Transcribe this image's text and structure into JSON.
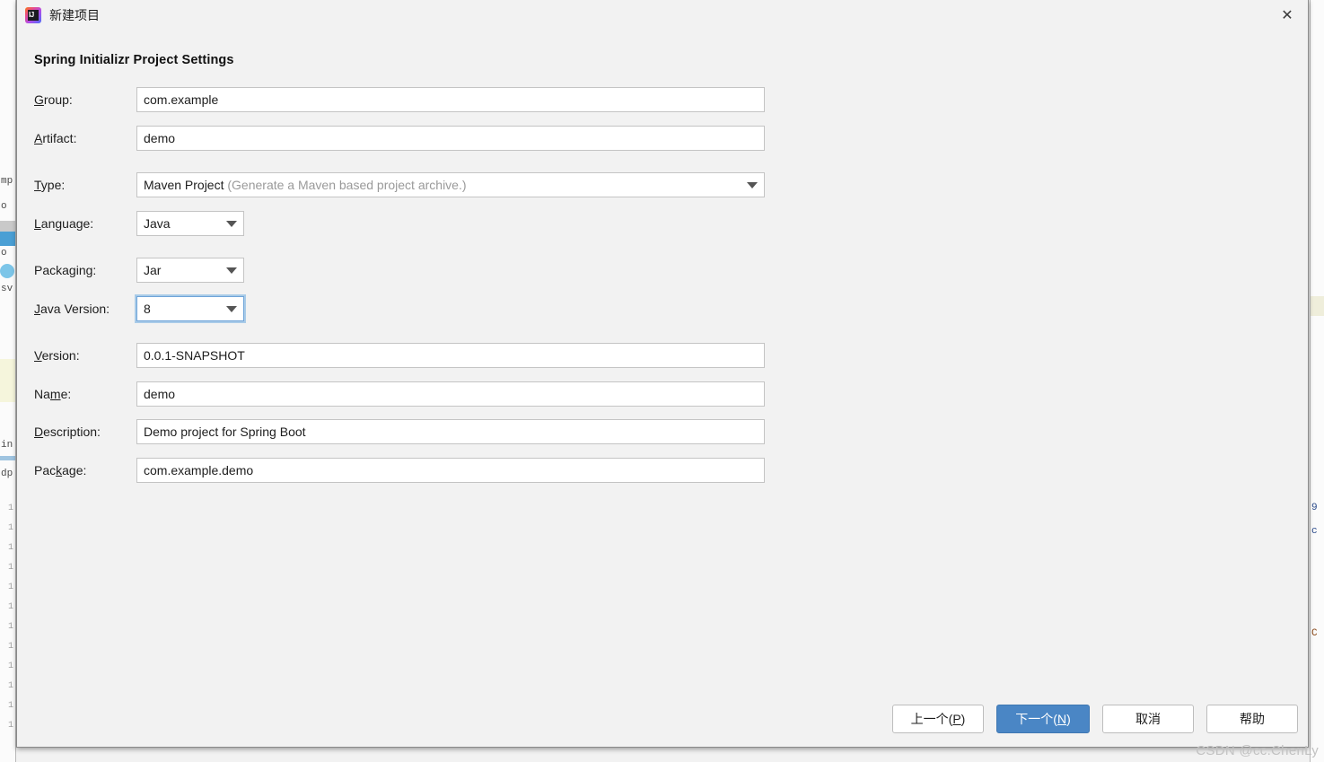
{
  "window": {
    "title": "新建项目",
    "icon": "intellij-idea-icon",
    "icon_mark": "IJ",
    "close_label": "✕"
  },
  "dialog": {
    "heading": "Spring Initializr Project Settings"
  },
  "fields": {
    "group": {
      "label_pre": "",
      "label_mnemonic": "G",
      "label_post": "roup:",
      "value": "com.example",
      "placeholder": ""
    },
    "artifact": {
      "label_pre": "",
      "label_mnemonic": "A",
      "label_post": "rtifact:",
      "value": "demo",
      "placeholder": ""
    },
    "type": {
      "label_pre": "",
      "label_mnemonic": "T",
      "label_post": "ype:",
      "value": "Maven Project",
      "hint": " (Generate a Maven based project archive.)"
    },
    "language": {
      "label_pre": "",
      "label_mnemonic": "L",
      "label_post": "anguage:",
      "value": "Java"
    },
    "packaging": {
      "label_pre": "Packa",
      "label_mnemonic": "g",
      "label_post": "ing:",
      "value": "Jar"
    },
    "java_version": {
      "label_pre": "",
      "label_mnemonic": "J",
      "label_post": "ava Version:",
      "value": "8",
      "focused": true
    },
    "version": {
      "label_pre": "",
      "label_mnemonic": "V",
      "label_post": "ersion:",
      "value": "0.0.1-SNAPSHOT"
    },
    "name": {
      "label_pre": "Na",
      "label_mnemonic": "m",
      "label_post": "e:",
      "value": "demo"
    },
    "description": {
      "label_pre": "",
      "label_mnemonic": "D",
      "label_post": "escription:",
      "value": "Demo project for Spring Boot"
    },
    "package": {
      "label_pre": "Pac",
      "label_mnemonic": "k",
      "label_post": "age:",
      "value": "com.example.demo"
    }
  },
  "footer": {
    "previous": {
      "pre": "上一个(",
      "mnemonic": "P",
      "post": ")"
    },
    "next": {
      "pre": "下一个(",
      "mnemonic": "N",
      "post": ")"
    },
    "cancel": "取消",
    "help": "帮助"
  },
  "watermark": "CSDN @cc.ChenLy",
  "colors": {
    "dialog_background": "#f2f2f2",
    "primary_button": "#4a86c5",
    "focus_ring": "#a9cbe8",
    "field_border": "#c4c4c4",
    "hint_text": "#9a9a9a",
    "watermark": "#c2c2c2"
  },
  "background": {
    "gutter_numbers": [
      "1",
      "1",
      "1",
      "1",
      "1",
      "1",
      "1",
      "1",
      "1",
      "1",
      "1",
      "1"
    ],
    "left_fragments": [
      "mp",
      "o",
      "o",
      "sv",
      "in",
      "dp"
    ],
    "right_fragments": [
      "9",
      "c",
      "C"
    ]
  }
}
